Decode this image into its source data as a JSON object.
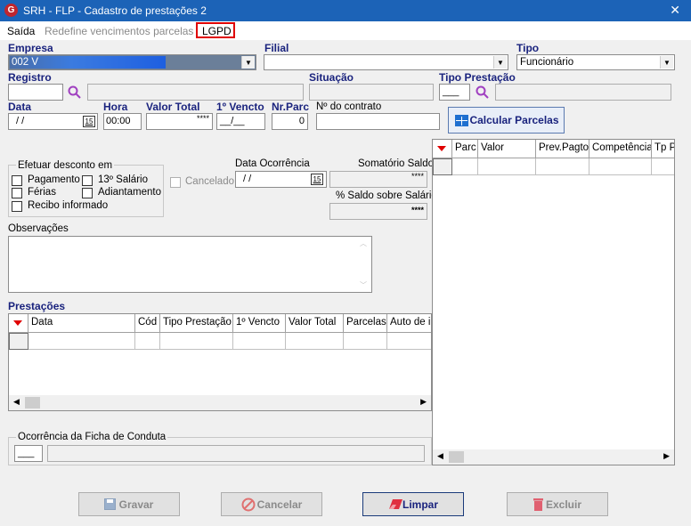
{
  "window": {
    "title": "SRH - FLP - Cadastro de prestações 2",
    "close": "✕",
    "icon_letter": "G"
  },
  "menu": {
    "saida": "Saída",
    "redefine": "Redefine vencimentos parcelas",
    "lgpd": "LGPD"
  },
  "fields": {
    "empresa_label": "Empresa",
    "empresa_value": "002 V",
    "filial_label": "Filial",
    "filial_value": "",
    "tipo_label": "Tipo",
    "tipo_value": "Funcionário",
    "registro_label": "Registro",
    "situacao_label": "Situação",
    "tipo_prestacao_label": "Tipo Prestação",
    "tipo_prestacao_value": "___",
    "data_label": "Data",
    "data_value": "/ /",
    "hora_label": "Hora",
    "hora_value": "00:00",
    "valor_total_label": "Valor Total",
    "valor_total_value": "****",
    "vencto_label": "1º Vencto",
    "vencto_value": "__/__",
    "nr_parc_label": "Nr.Parc",
    "nr_parc_value": "0",
    "contrato_label": "Nº do contrato",
    "calendar_day": "15"
  },
  "buttons": {
    "calcular": "Calcular Parcelas",
    "gravar": "Gravar",
    "cancelar": "Cancelar",
    "limpar": "Limpar",
    "excluir": "Excluir"
  },
  "desconto": {
    "title": "Efetuar desconto em",
    "pagamento": "Pagamento",
    "salario13": "13º Salário",
    "ferias": "Férias",
    "adiantamento": "Adiantamento",
    "recibo": "Recibo informado"
  },
  "cancelado": "Cancelado",
  "ocorrencia": {
    "label": "Data Ocorrência",
    "value": "/ /"
  },
  "saldo": {
    "somatorio_label": "Somatório Saldo",
    "somatorio_value": "****",
    "percent_label": "% Saldo sobre Salário",
    "percent_value": "****"
  },
  "observacoes_label": "Observações",
  "prestacoes": {
    "label": "Prestações",
    "columns": [
      "Data",
      "Cód",
      "Tipo Prestação",
      "1º Vencto",
      "Valor Total",
      "Parcelas",
      "Auto de i"
    ]
  },
  "parcelas": {
    "columns": [
      "Parc",
      "Valor",
      "Prev.Pagto",
      "Competência",
      "Tp Pa"
    ]
  },
  "ficha": {
    "label": "Ocorrência da Ficha de Conduta",
    "code": "___"
  },
  "colors": {
    "titlebar": "#1c63b7",
    "label_blue": "#1a237e",
    "highlight": "#e00000"
  }
}
